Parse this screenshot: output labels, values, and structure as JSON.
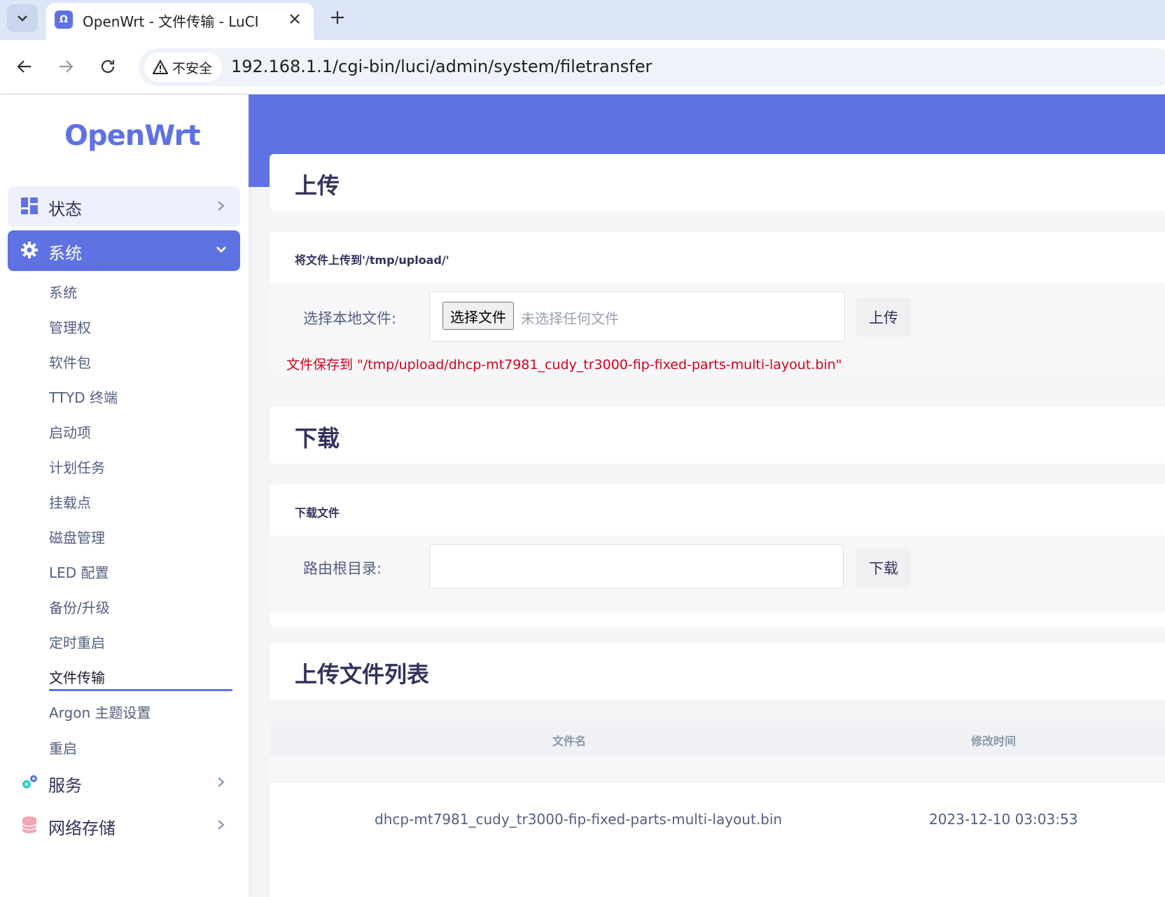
{
  "browser": {
    "tab_title": "OpenWrt - 文件传输 - LuCI",
    "security_label": "不安全",
    "url": "192.168.1.1/cgi-bin/luci/admin/system/filetransfer"
  },
  "sidebar": {
    "logo": "OpenWrt",
    "status_label": "状态",
    "system_label": "系统",
    "system_items": [
      "系统",
      "管理权",
      "软件包",
      "TTYD 终端",
      "启动项",
      "计划任务",
      "挂载点",
      "磁盘管理",
      "LED 配置",
      "备份/升级",
      "定时重启",
      "文件传输",
      "Argon 主题设置",
      "重启"
    ],
    "active_item": "文件传输",
    "service_label": "服务",
    "storage_label": "网络存储"
  },
  "upload": {
    "title": "上传",
    "section_label": "将文件上传到'/tmp/upload/'",
    "field_label": "选择本地文件:",
    "choose_button": "选择文件",
    "no_file_text": "未选择任何文件",
    "upload_button": "上传",
    "message": "文件保存到 \"/tmp/upload/dhcp-mt7981_cudy_tr3000-fip-fixed-parts-multi-layout.bin\""
  },
  "download": {
    "title": "下载",
    "section_label": "下载文件",
    "field_label": "路由根目录:",
    "path_value": "",
    "download_button": "下载"
  },
  "filelist": {
    "title": "上传文件列表",
    "col_name": "文件名",
    "col_mtime": "修改时间",
    "rows": [
      {
        "name": "dhcp-mt7981_cudy_tr3000-fip-fixed-parts-multi-layout.bin",
        "mtime": "2023-12-10 03:03:53"
      }
    ]
  },
  "colors": {
    "accent": "#5e72e4",
    "error": "#d0021b"
  }
}
